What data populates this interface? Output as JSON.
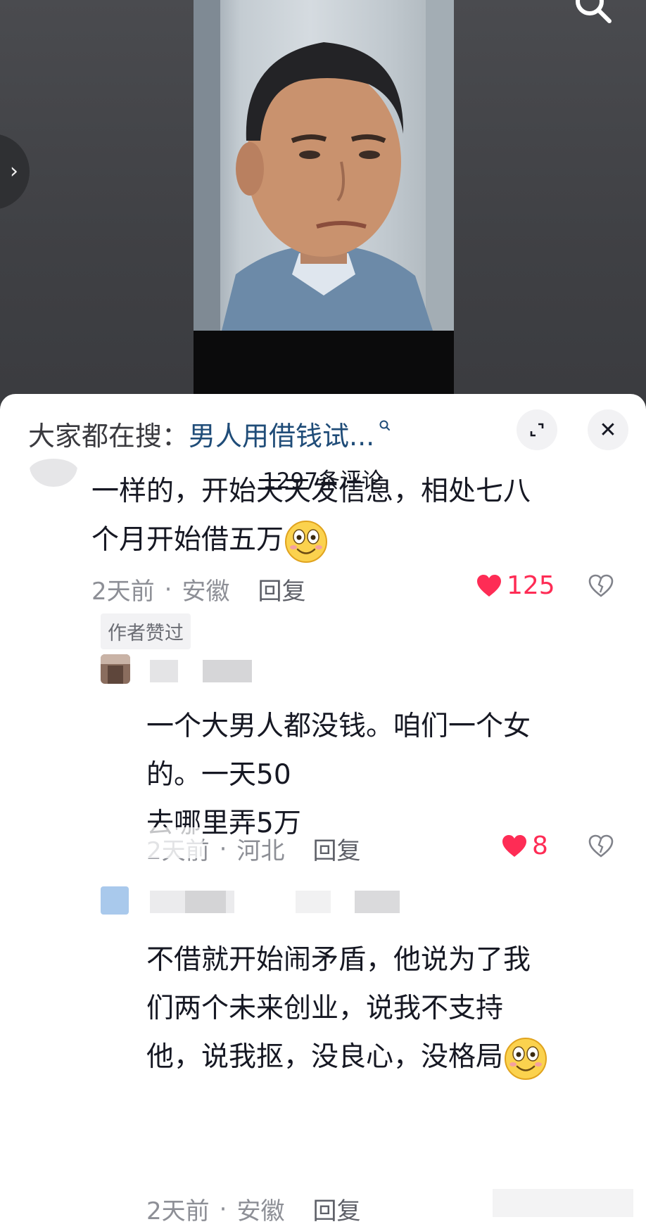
{
  "header": {
    "search_prefix": "大家都在搜：",
    "search_term": "男人用借钱试...",
    "comment_count": "1297条评论"
  },
  "comments": [
    {
      "text_lines": [
        "一样的，开始天天发信息，相处七八",
        "个月开始借五万"
      ],
      "time": "2天前",
      "location": "安徽",
      "reply_label": "回复",
      "likes": "125",
      "tag": "作者赞过"
    },
    {
      "text_lines": [
        "一个大男人都没钱。咱们一个女",
        "的。一天50",
        "去哪里弄5万"
      ],
      "time": "2天前",
      "location": "河北",
      "reply_label": "回复",
      "likes": "8"
    },
    {
      "text_lines": [
        "不借就开始闹矛盾，他说为了我",
        "们两个未来创业，说我不支持",
        "他，说我抠，没良心，没格局"
      ],
      "time": "2天前",
      "location": "安徽",
      "reply_label": "回复"
    }
  ],
  "colors": {
    "like_red": "#fe2c55",
    "link_blue": "#1f4c78",
    "meta_gray": "#8d8f96"
  }
}
